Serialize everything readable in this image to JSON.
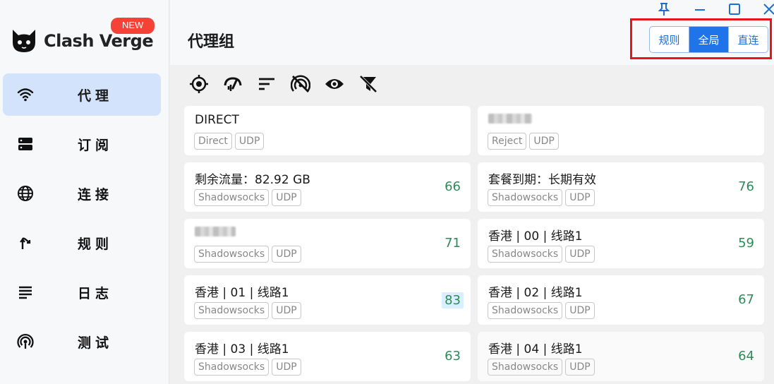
{
  "app": {
    "brand": "Clash Verge",
    "new_badge": "NEW"
  },
  "sidebar": {
    "items": [
      {
        "label": "代理",
        "icon": "wifi-icon",
        "active": true
      },
      {
        "label": "订阅",
        "icon": "server-icon",
        "active": false
      },
      {
        "label": "连接",
        "icon": "globe-icon",
        "active": false
      },
      {
        "label": "规则",
        "icon": "fork-arrow-icon",
        "active": false
      },
      {
        "label": "日志",
        "icon": "lines-icon",
        "active": false
      },
      {
        "label": "测试",
        "icon": "broadcast-icon",
        "active": false
      }
    ]
  },
  "header": {
    "title": "代理组",
    "mode": {
      "options": [
        "规则",
        "全局",
        "直连"
      ],
      "selected": "全局"
    }
  },
  "window_controls": [
    "pin-icon",
    "minimize-icon",
    "maximize-icon",
    "close-icon"
  ],
  "toolbar": [
    "locate-icon",
    "speed-test-icon",
    "sort-icon",
    "url-test-off-icon",
    "eye-icon",
    "filter-off-icon"
  ],
  "colors": {
    "accent": "#1e74e8",
    "active_nav": "#d3e3fb",
    "delay_good": "#2e8b57",
    "highlight_box": "#e8141b",
    "badge": "#f44336"
  },
  "proxies": [
    {
      "name": "DIRECT",
      "tags": [
        "Direct",
        "UDP"
      ],
      "delay": ""
    },
    {
      "name": "",
      "blurred": true,
      "tags": [
        "Reject",
        "UDP"
      ],
      "delay": ""
    },
    {
      "name": "剩余流量：82.92 GB",
      "tags": [
        "Shadowsocks",
        "UDP"
      ],
      "delay": "66"
    },
    {
      "name": "套餐到期：长期有效",
      "tags": [
        "Shadowsocks",
        "UDP"
      ],
      "delay": "76"
    },
    {
      "name": "",
      "blurred": true,
      "tags": [
        "Shadowsocks",
        "UDP"
      ],
      "delay": "71"
    },
    {
      "name": "香港 | 00 | 线路1",
      "tags": [
        "Shadowsocks",
        "UDP"
      ],
      "delay": "59"
    },
    {
      "name": "香港 | 01 | 线路1",
      "tags": [
        "Shadowsocks",
        "UDP"
      ],
      "delay": "83",
      "highlight": true
    },
    {
      "name": "香港 | 02 | 线路1",
      "tags": [
        "Shadowsocks",
        "UDP"
      ],
      "delay": "67"
    },
    {
      "name": "香港 | 03 | 线路1",
      "tags": [
        "Shadowsocks",
        "UDP"
      ],
      "delay": "63"
    },
    {
      "name": "香港 | 04 | 线路1",
      "tags": [
        "Shadowsocks",
        "UDP"
      ],
      "delay": "64"
    }
  ]
}
